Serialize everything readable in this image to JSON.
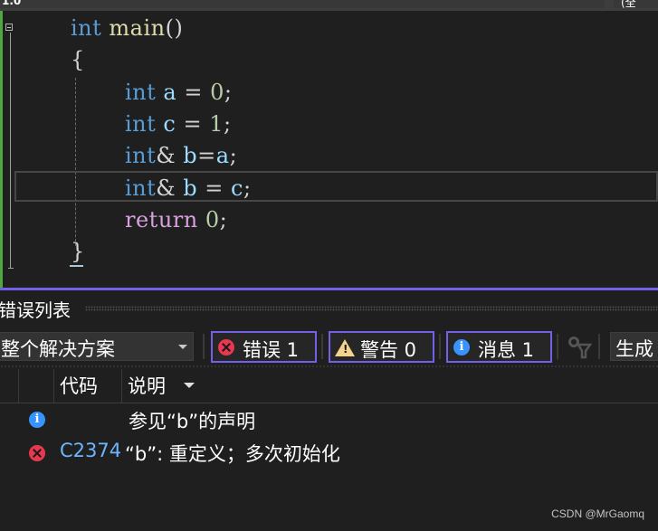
{
  "top_tabs": {
    "left_fragment": "1.0",
    "right_fragment": "(全"
  },
  "editor": {
    "lines": [
      {
        "tokens": [
          {
            "t": "int",
            "c": "kw"
          },
          {
            "t": " "
          },
          {
            "t": "main",
            "c": "fn"
          },
          {
            "t": "()",
            "c": "pun"
          }
        ]
      },
      {
        "tokens": [
          {
            "t": "{",
            "c": "pun"
          }
        ]
      },
      {
        "tokens": [
          {
            "t": "int",
            "c": "kw"
          },
          {
            "t": " "
          },
          {
            "t": "a",
            "c": "var"
          },
          {
            "t": " = ",
            "c": "pun"
          },
          {
            "t": "0",
            "c": "num"
          },
          {
            "t": ";",
            "c": "pun"
          }
        ]
      },
      {
        "tokens": [
          {
            "t": "int",
            "c": "kw"
          },
          {
            "t": " "
          },
          {
            "t": "c",
            "c": "var"
          },
          {
            "t": " = ",
            "c": "pun"
          },
          {
            "t": "1",
            "c": "num"
          },
          {
            "t": ";",
            "c": "pun"
          }
        ]
      },
      {
        "tokens": [
          {
            "t": "int",
            "c": "kw"
          },
          {
            "t": "&",
            "c": "pun"
          },
          {
            "t": " "
          },
          {
            "t": "b",
            "c": "var"
          },
          {
            "t": "=",
            "c": "pun"
          },
          {
            "t": "a",
            "c": "var"
          },
          {
            "t": ";",
            "c": "pun"
          }
        ]
      },
      {
        "tokens": [
          {
            "t": "int",
            "c": "kw"
          },
          {
            "t": "&",
            "c": "pun"
          },
          {
            "t": " "
          },
          {
            "t": "b",
            "c": "var"
          },
          {
            "t": " = ",
            "c": "pun"
          },
          {
            "t": "c",
            "c": "var"
          },
          {
            "t": ";",
            "c": "pun"
          }
        ]
      },
      {
        "tokens": [
          {
            "t": "return",
            "c": "ret"
          },
          {
            "t": " "
          },
          {
            "t": "0",
            "c": "num"
          },
          {
            "t": ";",
            "c": "pun"
          }
        ]
      },
      {
        "tokens": [
          {
            "t": "}",
            "c": "pun"
          }
        ]
      }
    ],
    "line_text": [
      "int main()",
      "{",
      "int a = 0;",
      "int c = 1;",
      "int& b=a;",
      "int& b = c;",
      "return 0;",
      "}"
    ]
  },
  "error_list": {
    "title": "错误列表",
    "scope": "整个解决方案",
    "filters": {
      "errors": {
        "label": "错误 1",
        "count": 1
      },
      "warnings": {
        "label": "警告 0",
        "count": 0
      },
      "messages": {
        "label": "消息 1",
        "count": 1
      }
    },
    "build_source": "生成 + IntelliSense",
    "build_source_visible": "生成",
    "columns": {
      "code": "代码",
      "description": "说明"
    },
    "rows": [
      {
        "icon": "info-icon",
        "code": "",
        "description": "参见“b”的声明"
      },
      {
        "icon": "error-icon",
        "code": "C2374",
        "description": "“b”: 重定义；多次初始化"
      }
    ]
  },
  "colors": {
    "accent": "#7160e8",
    "error": "#e8384f",
    "warning": "#f5d38e",
    "info": "#3794ff",
    "keyword": "#569cd6",
    "function": "#dcdcaa",
    "variable": "#9cdcfe",
    "number": "#b5cea8",
    "control": "#d8a0df",
    "change_bar": "#4ea73f"
  },
  "watermark": "CSDN @MrGaomq"
}
